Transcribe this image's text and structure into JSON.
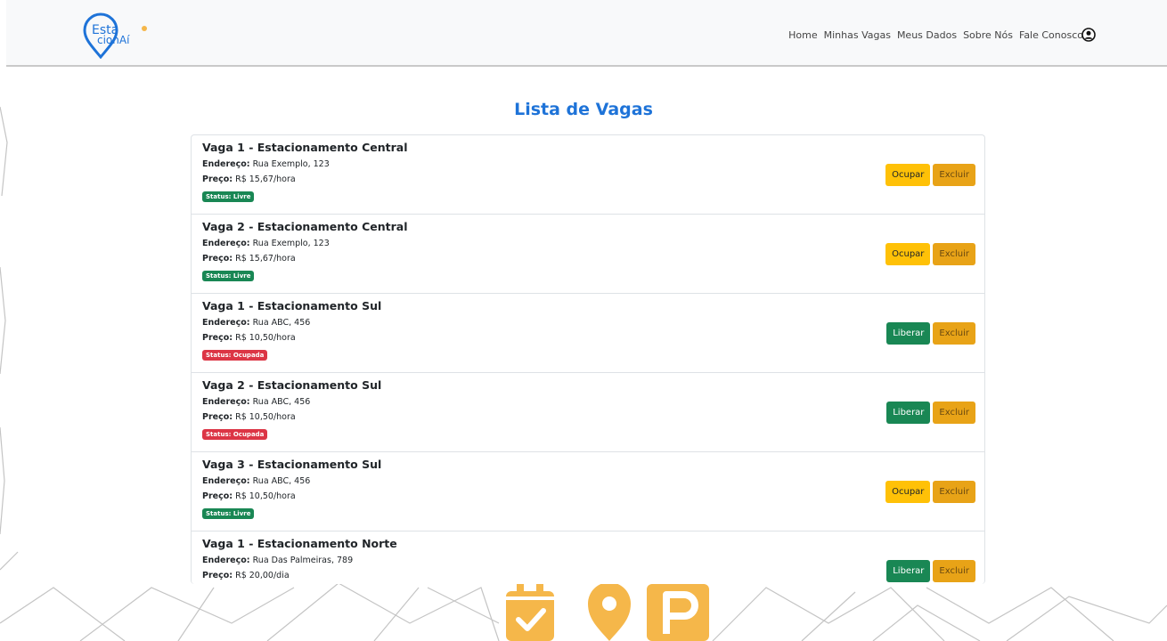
{
  "brand": {
    "logo_line1": "Esta",
    "logo_line2": "cionAí"
  },
  "nav": {
    "links": [
      "Home",
      "Minhas Vagas",
      "Meus Dados",
      "Sobre Nós",
      "Fale Conosco"
    ]
  },
  "page_title": "Lista de Vagas",
  "labels": {
    "endereco": "Endereço:",
    "preco": "Preço:",
    "ocupar": "Ocupar",
    "liberar": "Liberar",
    "excluir": "Excluir"
  },
  "vagas": [
    {
      "title": "Vaga 1 - Estacionamento Central",
      "endereco": "Rua Exemplo, 123",
      "preco": "R$ 15,67/hora",
      "status": "Status: Livre"
    },
    {
      "title": "Vaga 2 - Estacionamento Central",
      "endereco": "Rua Exemplo, 123",
      "preco": "R$ 15,67/hora",
      "status": "Status: Livre"
    },
    {
      "title": "Vaga 1 - Estacionamento Sul",
      "endereco": "Rua ABC, 456",
      "preco": "R$ 10,50/hora",
      "status": "Status: Ocupada"
    },
    {
      "title": "Vaga 2 - Estacionamento Sul",
      "endereco": "Rua ABC, 456",
      "preco": "R$ 10,50/hora",
      "status": "Status: Ocupada"
    },
    {
      "title": "Vaga 3 - Estacionamento Sul",
      "endereco": "Rua ABC, 456",
      "preco": "R$ 10,50/hora",
      "status": "Status: Livre"
    },
    {
      "title": "Vaga 1 - Estacionamento Norte",
      "endereco": "Rua Das Palmeiras, 789",
      "preco": "R$ 20,00/dia",
      "status": ""
    }
  ],
  "colors": {
    "title_blue": "#1e73d8",
    "logo_blue": "#1e73d8",
    "warning": "#ffc107",
    "excluir": "#e8a317",
    "success": "#198754",
    "danger": "#dc3545",
    "icon_orange": "#f5b74a"
  },
  "icons": [
    "user-circle-icon",
    "calendar-check-icon",
    "map-pin-icon",
    "parking-icon"
  ]
}
